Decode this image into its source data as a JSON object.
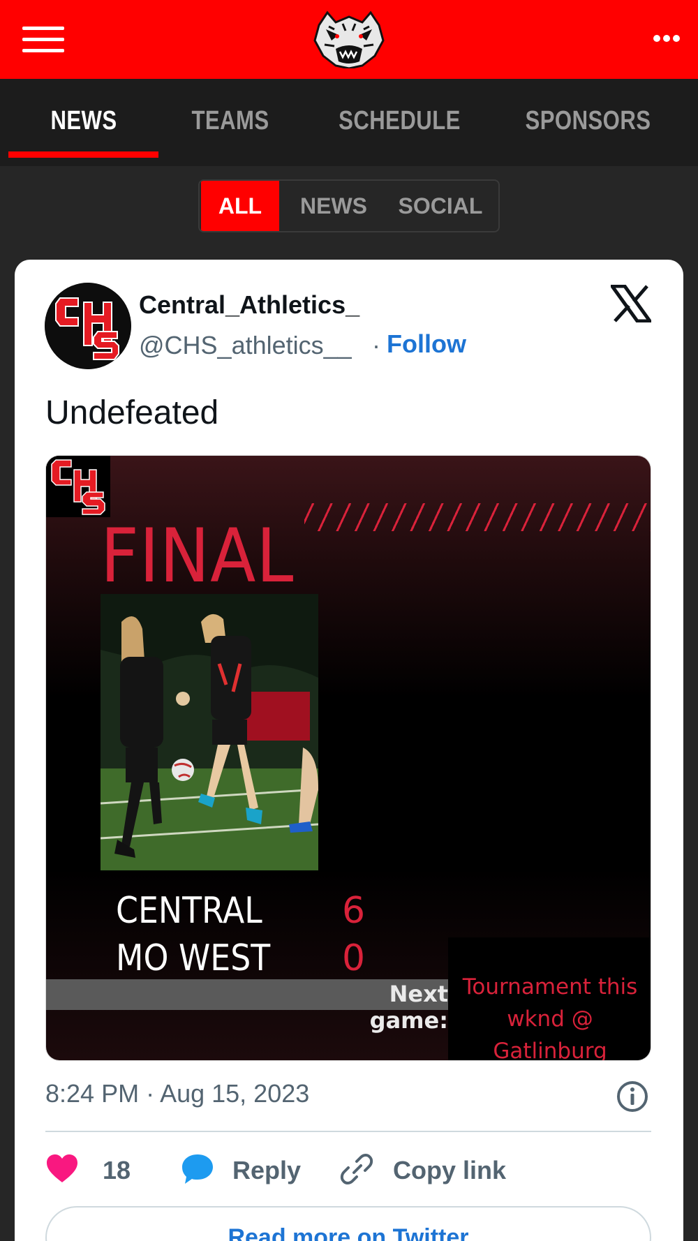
{
  "header": {
    "menu_icon": "hamburger-menu-icon",
    "logo": "wildcat-logo",
    "more_icon": "more-dots-icon",
    "colors": {
      "brand_red": "#ff0000",
      "nav_bg": "#1c1c1c",
      "page_bg": "#262626"
    }
  },
  "nav": {
    "tabs": [
      {
        "label": "NEWS",
        "active": true
      },
      {
        "label": "TEAMS",
        "active": false
      },
      {
        "label": "SCHEDULE",
        "active": false
      },
      {
        "label": "SPONSORS",
        "active": false
      }
    ]
  },
  "filter": {
    "options": [
      {
        "label": "ALL",
        "active": true
      },
      {
        "label": "NEWS",
        "active": false
      },
      {
        "label": "SOCIAL",
        "active": false
      }
    ]
  },
  "tweet": {
    "author_name": "Central_Athletics_",
    "handle": "@CHS_athletics__",
    "separator": "·",
    "follow_label": "Follow",
    "platform_icon": "x-logo-icon",
    "text": "Undefeated",
    "media": {
      "logo_text": "CHS",
      "headline": "FINAL",
      "teams": [
        {
          "name": "CENTRAL",
          "score": "6"
        },
        {
          "name": "MO WEST",
          "score": "0"
        }
      ],
      "next_label": "Next game:",
      "next_info_lines": [
        "Tournament this",
        "wknd @",
        "Gatlinburg"
      ]
    },
    "timestamp": "8:24 PM · Aug 15, 2023",
    "actions": {
      "likes": "18",
      "reply_label": "Reply",
      "copy_label": "Copy link"
    },
    "read_more_label": "Read more on Twitter",
    "colors": {
      "link_blue": "#1d74d4",
      "heart": "#f91880",
      "reply_blue": "#1d9bf0",
      "final_red": "#d9223a"
    }
  }
}
